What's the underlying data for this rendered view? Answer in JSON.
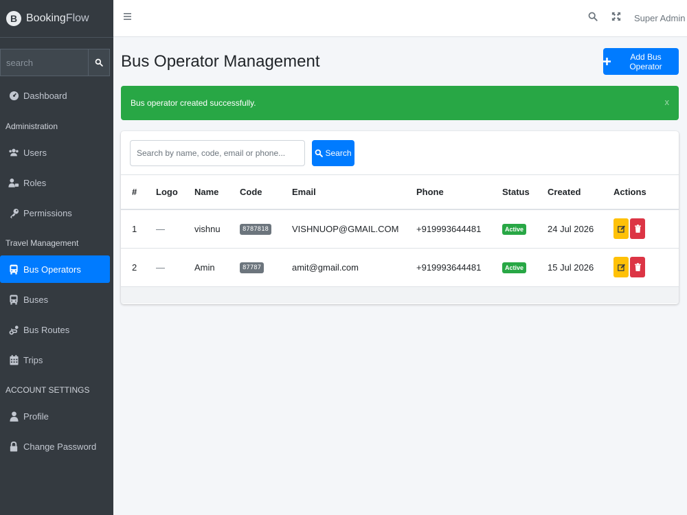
{
  "brand": {
    "name_prefix": "Booking",
    "name_suffix": "Flow",
    "logo_letter": "B"
  },
  "sidebar": {
    "search_placeholder": "search",
    "items": [
      {
        "label": "Dashboard",
        "icon": "dashboard-icon"
      },
      {
        "header": "Administration"
      },
      {
        "label": "Users",
        "icon": "users-icon"
      },
      {
        "label": "Roles",
        "icon": "user-tag-icon"
      },
      {
        "label": "Permissions",
        "icon": "key-icon"
      },
      {
        "header": "Travel Management"
      },
      {
        "label": "Bus Operators",
        "icon": "bus-icon",
        "active": true
      },
      {
        "label": "Buses",
        "icon": "bus-icon"
      },
      {
        "label": "Bus Routes",
        "icon": "route-icon"
      },
      {
        "label": "Trips",
        "icon": "calendar-icon"
      },
      {
        "header": "ACCOUNT SETTINGS"
      },
      {
        "label": "Profile",
        "icon": "user-icon"
      },
      {
        "label": "Change Password",
        "icon": "lock-icon"
      }
    ]
  },
  "topbar": {
    "user": "Super Admin"
  },
  "page": {
    "title": "Bus Operator Management",
    "add_button": "Add Bus Operator",
    "alert": "Bus operator created successfully.",
    "alert_close": "x"
  },
  "search": {
    "placeholder": "Search by name, code, email or phone...",
    "button": "Search"
  },
  "table": {
    "headers": [
      "#",
      "Logo",
      "Name",
      "Code",
      "Email",
      "Phone",
      "Status",
      "Created",
      "Actions"
    ],
    "rows": [
      {
        "num": "1",
        "logo": "—",
        "name": "vishnu",
        "code": "8787818",
        "email": "VISHNUOP@GMAIL.COM",
        "phone": "+919993644481",
        "status": "Active",
        "created": "24 Jul 2026"
      },
      {
        "num": "2",
        "logo": "—",
        "name": "Amin",
        "code": "87787",
        "email": "amit@gmail.com",
        "phone": "+919993644481",
        "status": "Active",
        "created": "15 Jul 2026"
      }
    ]
  },
  "colors": {
    "primary": "#007bff",
    "success": "#28a745",
    "warning": "#ffc107",
    "danger": "#dc3545",
    "sidebar": "#343a40"
  }
}
